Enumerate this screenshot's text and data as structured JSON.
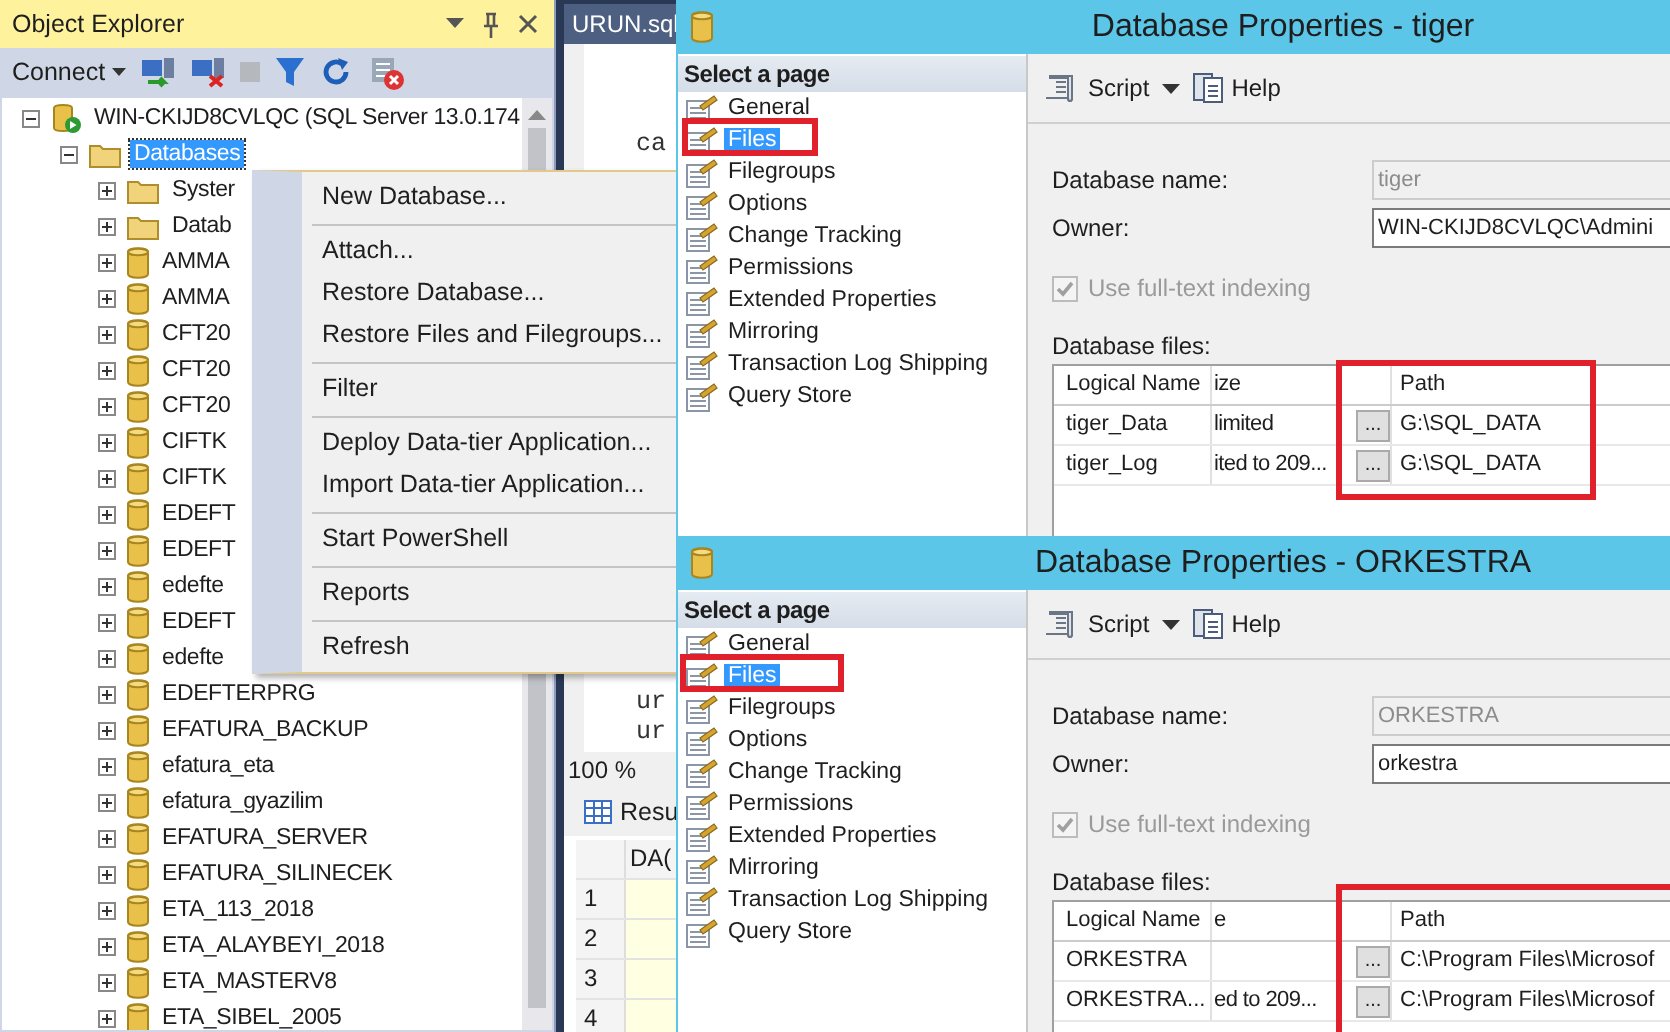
{
  "object_explorer": {
    "title": "Object Explorer",
    "connect": "Connect",
    "tree": [
      {
        "label": "WIN-CKIJD8CVLQC (SQL Server 13.0.174",
        "kind": "server",
        "expanded": true,
        "selected": false,
        "children": [
          {
            "label": "Databases",
            "kind": "folder",
            "expanded": true,
            "selected": true,
            "children": [
              {
                "label": "Syster",
                "kind": "folder",
                "expanded": false,
                "selected": false
              },
              {
                "label": "Datab",
                "kind": "folder",
                "expanded": false,
                "selected": false
              },
              {
                "label": "AMMA",
                "kind": "database",
                "expanded": false,
                "selected": false
              },
              {
                "label": "AMMA",
                "kind": "database",
                "expanded": false,
                "selected": false
              },
              {
                "label": "CFT20",
                "kind": "database",
                "expanded": false,
                "selected": false
              },
              {
                "label": "CFT20",
                "kind": "database",
                "expanded": false,
                "selected": false
              },
              {
                "label": "CFT20",
                "kind": "database",
                "expanded": false,
                "selected": false
              },
              {
                "label": "CIFTK",
                "kind": "database",
                "expanded": false,
                "selected": false
              },
              {
                "label": "CIFTK",
                "kind": "database",
                "expanded": false,
                "selected": false
              },
              {
                "label": "EDEFT",
                "kind": "database",
                "expanded": false,
                "selected": false
              },
              {
                "label": "EDEFT",
                "kind": "database",
                "expanded": false,
                "selected": false
              },
              {
                "label": "edefte",
                "kind": "database",
                "expanded": false,
                "selected": false
              },
              {
                "label": "EDEFT",
                "kind": "database",
                "expanded": false,
                "selected": false
              },
              {
                "label": "edefte",
                "kind": "database",
                "expanded": false,
                "selected": false
              },
              {
                "label": "EDEFTERPRG",
                "kind": "database",
                "expanded": false,
                "selected": false
              },
              {
                "label": "EFATURA_BACKUP",
                "kind": "database",
                "expanded": false,
                "selected": false
              },
              {
                "label": "efatura_eta",
                "kind": "database",
                "expanded": false,
                "selected": false
              },
              {
                "label": "efatura_gyazilim",
                "kind": "database",
                "expanded": false,
                "selected": false
              },
              {
                "label": "EFATURA_SERVER",
                "kind": "database",
                "expanded": false,
                "selected": false
              },
              {
                "label": "EFATURA_SILINECEK",
                "kind": "database",
                "expanded": false,
                "selected": false
              },
              {
                "label": "ETA_113_2018",
                "kind": "database",
                "expanded": false,
                "selected": false
              },
              {
                "label": "ETA_ALAYBEYI_2018",
                "kind": "database",
                "expanded": false,
                "selected": false
              },
              {
                "label": "ETA_MASTERV8",
                "kind": "database",
                "expanded": false,
                "selected": false
              },
              {
                "label": "ETA_SIBEL_2005",
                "kind": "database",
                "expanded": false,
                "selected": false
              }
            ]
          }
        ]
      }
    ]
  },
  "context_menu": {
    "items": [
      {
        "kind": "item",
        "label": "New Database..."
      },
      {
        "kind": "separator"
      },
      {
        "kind": "item",
        "label": "Attach..."
      },
      {
        "kind": "item",
        "label": "Restore Database..."
      },
      {
        "kind": "item",
        "label": "Restore Files and Filegroups..."
      },
      {
        "kind": "separator"
      },
      {
        "kind": "item",
        "label": "Filter"
      },
      {
        "kind": "separator"
      },
      {
        "kind": "item",
        "label": "Deploy Data-tier Application..."
      },
      {
        "kind": "item",
        "label": "Import Data-tier Application..."
      },
      {
        "kind": "separator"
      },
      {
        "kind": "item",
        "label": "Start PowerShell"
      },
      {
        "kind": "separator"
      },
      {
        "kind": "item",
        "label": "Reports"
      },
      {
        "kind": "separator"
      },
      {
        "kind": "item",
        "label": "Refresh"
      }
    ]
  },
  "editor": {
    "tab": "URUN.sql",
    "lines_top": [
      "ca"
    ],
    "lines_bottom": [
      "ur",
      "ur"
    ],
    "zoom": "100 %",
    "results_tab": "Resu",
    "grid_header": "DA(",
    "row_numbers": [
      "1",
      "2",
      "3",
      "4"
    ]
  },
  "dialogs": [
    {
      "title": "Database Properties - tiger",
      "pages_header": "Select a page",
      "pages": [
        {
          "label": "General",
          "selected": false
        },
        {
          "label": "Files",
          "selected": true
        },
        {
          "label": "Filegroups",
          "selected": false
        },
        {
          "label": "Options",
          "selected": false
        },
        {
          "label": "Change Tracking",
          "selected": false
        },
        {
          "label": "Permissions",
          "selected": false
        },
        {
          "label": "Extended Properties",
          "selected": false
        },
        {
          "label": "Mirroring",
          "selected": false
        },
        {
          "label": "Transaction Log Shipping",
          "selected": false
        },
        {
          "label": "Query Store",
          "selected": false
        }
      ],
      "script": "Script",
      "help": "Help",
      "name_label": "Database name:",
      "name_value": "tiger",
      "owner_label": "Owner:",
      "owner_value": "WIN-CKIJD8CVLQC\\Admini",
      "fulltext": {
        "label": "Use full-text indexing",
        "checked": true,
        "disabled": true
      },
      "files_label": "Database files:",
      "columns": [
        "Logical Name",
        "ize",
        "Path"
      ],
      "rows": [
        {
          "logical_name": "tiger_Data",
          "size": "limited",
          "browse": "...",
          "path": "G:\\SQL_DATA"
        },
        {
          "logical_name": "tiger_Log",
          "size": "ited to 209...",
          "browse": "...",
          "path": "G:\\SQL_DATA"
        }
      ]
    },
    {
      "title": "Database Properties - ORKESTRA",
      "pages_header": "Select a page",
      "pages": [
        {
          "label": "General",
          "selected": false
        },
        {
          "label": "Files",
          "selected": true
        },
        {
          "label": "Filegroups",
          "selected": false
        },
        {
          "label": "Options",
          "selected": false
        },
        {
          "label": "Change Tracking",
          "selected": false
        },
        {
          "label": "Permissions",
          "selected": false
        },
        {
          "label": "Extended Properties",
          "selected": false
        },
        {
          "label": "Mirroring",
          "selected": false
        },
        {
          "label": "Transaction Log Shipping",
          "selected": false
        },
        {
          "label": "Query Store",
          "selected": false
        }
      ],
      "script": "Script",
      "help": "Help",
      "name_label": "Database name:",
      "name_value": "ORKESTRA",
      "owner_label": "Owner:",
      "owner_value": "orkestra",
      "fulltext": {
        "label": "Use full-text indexing",
        "checked": true,
        "disabled": true
      },
      "files_label": "Database files:",
      "columns": [
        "Logical Name",
        "e",
        "Path"
      ],
      "rows": [
        {
          "logical_name": "ORKESTRA",
          "browse": "...",
          "path": "C:\\Program Files\\Microsof"
        },
        {
          "logical_name": "ORKESTRA...",
          "size": "ed to 209...",
          "browse": "...",
          "path": "C:\\Program Files\\Microsof"
        }
      ]
    }
  ]
}
